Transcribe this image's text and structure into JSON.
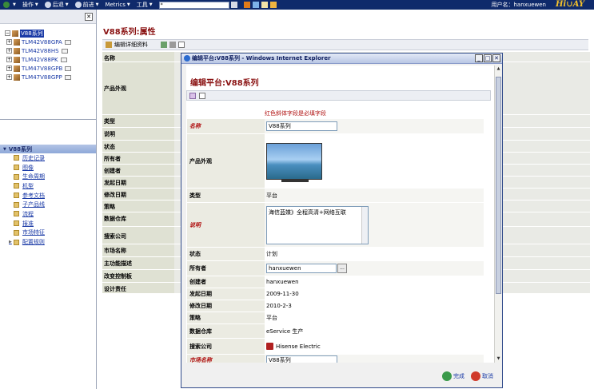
{
  "topbar": {
    "operation": "操作",
    "back": "后退",
    "forward": "前进",
    "metrics": "Metrics",
    "tools": "工具",
    "address_value": "*",
    "user": "用户名：hanxuewen",
    "logo": "Hi∪AY"
  },
  "tree": {
    "root": "V88系列",
    "children": [
      "TLM42V88GPA",
      "TLM42V88HS",
      "TLM42V88PK",
      "TLM47V88GPB",
      "TLM47V88GPP"
    ]
  },
  "nav": {
    "title": "V88系列",
    "items": [
      "历史记录",
      "图像",
      "生命周期",
      "机型",
      "参考文档",
      "子产品线",
      "流程",
      "报准",
      "市场特征",
      "配置规则"
    ]
  },
  "main": {
    "title": "V88系列:属性",
    "edit_label": "编辑详细资料",
    "props": [
      "名称",
      "产品外观",
      "类型",
      "说明",
      "状态",
      "所有者",
      "创建者",
      "发起日期",
      "修改日期",
      "策略",
      "数据仓库",
      "搜索公司",
      "市场名称",
      "主功能描述",
      "改变控制板",
      "设计责任"
    ]
  },
  "modal": {
    "window_title": "编辑平台:V88系列 - Windows Internet Explorer",
    "heading": "编辑平台:V88系列",
    "required_note": "红色斜体字段是必填字段",
    "fields": {
      "name_label": "名称",
      "name_value": "V88系列",
      "appearance_label": "产品外观",
      "type_label": "类型",
      "type_value": "平台",
      "desc_label": "说明",
      "desc_value": "海信蓝媒》全程高清+网络互联",
      "state_label": "状态",
      "state_value": "计划",
      "owner_label": "所有者",
      "owner_value": "hanxuewen",
      "creator_label": "创建者",
      "creator_value": "hanxuewen",
      "start_label": "发起日期",
      "start_value": "2009-11-30",
      "modify_label": "修改日期",
      "modify_value": "2010-2-3",
      "policy_label": "策略",
      "policy_value": "平台",
      "vault_label": "数据仓库",
      "vault_value": "eService 生产",
      "company_label": "搜索公司",
      "company_value": "Hisense Electric",
      "market_label": "市场名称",
      "market_value": "V88系列"
    },
    "done": "完成",
    "cancel": "取消"
  },
  "colors": {
    "topbar": "#0f2a6b",
    "title_red": "#8a1212",
    "link_blue": "#1a3aa6"
  }
}
